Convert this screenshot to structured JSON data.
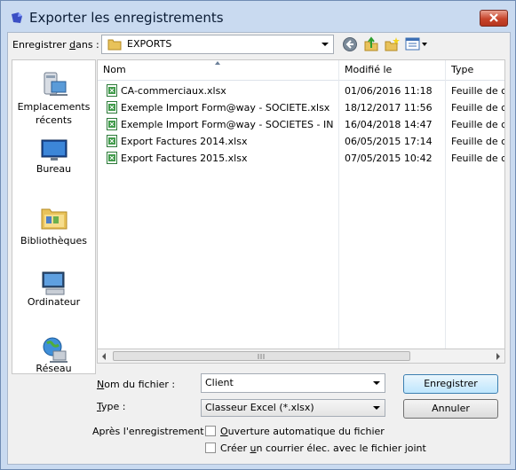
{
  "window": {
    "title": "Exporter les enregistrements",
    "close_icon": "close-icon",
    "accent": "#c9daf0"
  },
  "save_in": {
    "label_pre": "Enregistrer ",
    "label_u": "d",
    "label_post": "ans :",
    "value": "EXPORTS",
    "icons": [
      "back-icon",
      "up-folder-icon",
      "new-folder-icon",
      "view-menu-icon"
    ]
  },
  "places": [
    {
      "label": "Emplacements récents",
      "icon": "recent-places-icon"
    },
    {
      "label": "Bureau",
      "icon": "desktop-icon"
    },
    {
      "label": "Bibliothèques",
      "icon": "libraries-icon"
    },
    {
      "label": "Ordinateur",
      "icon": "computer-icon"
    },
    {
      "label": "Réseau",
      "icon": "network-icon"
    }
  ],
  "columns": [
    "Nom",
    "Modifié le",
    "Type"
  ],
  "files": [
    {
      "name": "CA-commerciaux.xlsx",
      "modified": "01/06/2016 11:18",
      "type": "Feuille de c"
    },
    {
      "name": "Exemple Import Form@way - SOCIETE.xlsx",
      "modified": "18/12/2017 11:56",
      "type": "Feuille de c"
    },
    {
      "name": "Exemple Import Form@way - SOCIETES - IN...",
      "modified": "16/04/2018 14:47",
      "type": "Feuille de c"
    },
    {
      "name": "Export Factures 2014.xlsx",
      "modified": "06/05/2015 17:14",
      "type": "Feuille de c"
    },
    {
      "name": "Export Factures 2015.xlsx",
      "modified": "07/05/2015 10:42",
      "type": "Feuille de c"
    }
  ],
  "filename": {
    "label_pre": "",
    "label_u": "N",
    "label_post": "om du fichier :",
    "value": "Client"
  },
  "filetype": {
    "label_pre": "",
    "label_u": "T",
    "label_post": "ype :",
    "value": "Classeur Excel (*.xlsx)"
  },
  "buttons": {
    "save": "Enregistrer",
    "cancel": "Annuler"
  },
  "after_save": {
    "label": "Après l'enregistrement :",
    "option1_u": "O",
    "option1_post": "uverture automatique du fichier",
    "option2_pre": "Créer ",
    "option2_u": "u",
    "option2_post": "n courrier élec. avec le fichier joint"
  }
}
